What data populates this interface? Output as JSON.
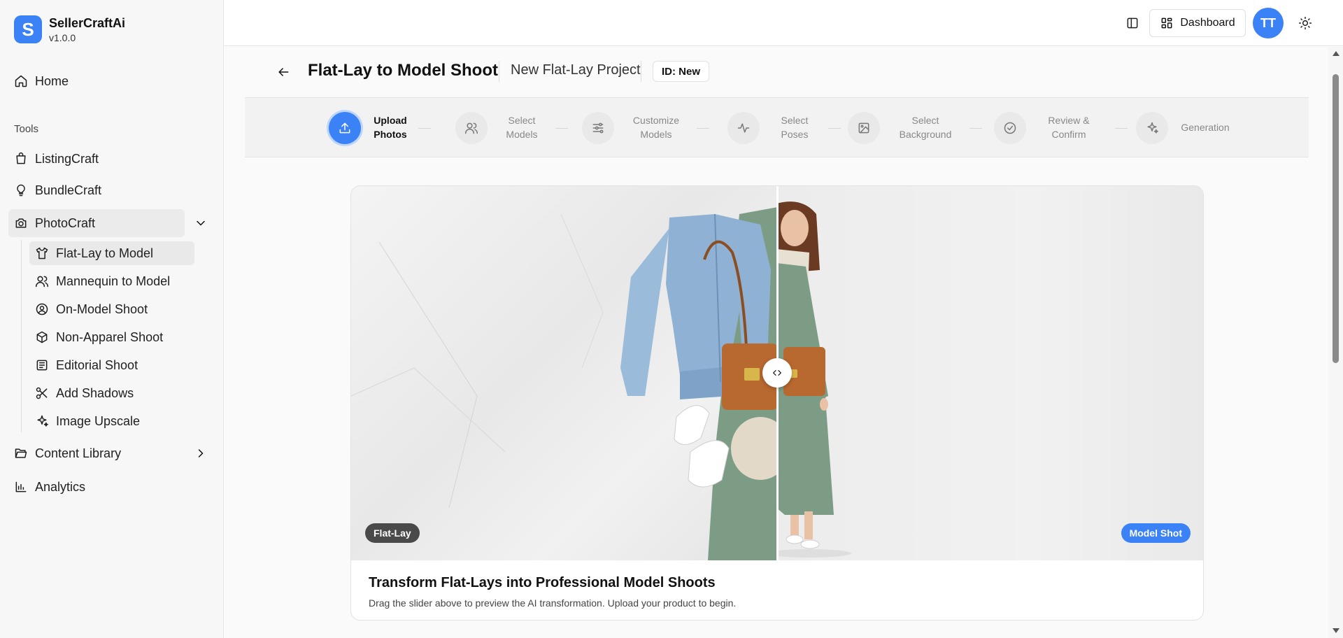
{
  "brand": {
    "name": "SellerCraftAi",
    "version": "v1.0.0",
    "logo_letter": "S"
  },
  "sidebar": {
    "home": "Home",
    "tools_label": "Tools",
    "items": [
      {
        "label": "ListingCraft",
        "icon": "shopping-bag-icon"
      },
      {
        "label": "BundleCraft",
        "icon": "lightbulb-icon"
      },
      {
        "label": "PhotoCraft",
        "icon": "camera-icon"
      }
    ],
    "photocraft_sub": [
      {
        "label": "Flat-Lay to Model",
        "icon": "shirt-icon"
      },
      {
        "label": "Mannequin to Model",
        "icon": "users-icon"
      },
      {
        "label": "On-Model Shoot",
        "icon": "user-circle-icon"
      },
      {
        "label": "Non-Apparel Shoot",
        "icon": "package-icon"
      },
      {
        "label": "Editorial Shoot",
        "icon": "newspaper-icon"
      },
      {
        "label": "Add Shadows",
        "icon": "scissors-icon"
      },
      {
        "label": "Image Upscale",
        "icon": "sparkles-icon"
      }
    ],
    "content_library": "Content Library",
    "analytics": "Analytics"
  },
  "topbar": {
    "dashboard_label": "Dashboard",
    "avatar_initials": "TT"
  },
  "header": {
    "title": "Flat-Lay to Model Shoot",
    "project_name": "New Flat-Lay Project",
    "id_badge": "ID: New"
  },
  "stepper": {
    "active_index": 0,
    "steps": [
      {
        "line1": "Upload",
        "line2": "Photos",
        "icon": "upload-icon"
      },
      {
        "line1": "Select",
        "line2": "Models",
        "icon": "users-icon"
      },
      {
        "line1": "Customize",
        "line2": "Models",
        "icon": "sliders-icon"
      },
      {
        "line1": "Select",
        "line2": "Poses",
        "icon": "activity-icon"
      },
      {
        "line1": "Select",
        "line2": "Background",
        "icon": "image-icon"
      },
      {
        "line1": "Review &",
        "line2": "Confirm",
        "icon": "check-circle-icon"
      },
      {
        "line1": "Generation",
        "line2": "",
        "icon": "sparkles-icon"
      }
    ]
  },
  "preview": {
    "left_badge": "Flat-Lay",
    "right_badge": "Model Shot",
    "slider_position": 0.5,
    "title": "Transform Flat-Lays into Professional Model Shoots",
    "description": "Drag the slider above to preview the AI transformation. Upload your product to begin."
  },
  "colors": {
    "accent": "#3b82f6",
    "sidebar_bg": "#f7f7f7",
    "dress": "#7d9c86",
    "denim": "#8fb1d4",
    "bag": "#b8692f"
  }
}
